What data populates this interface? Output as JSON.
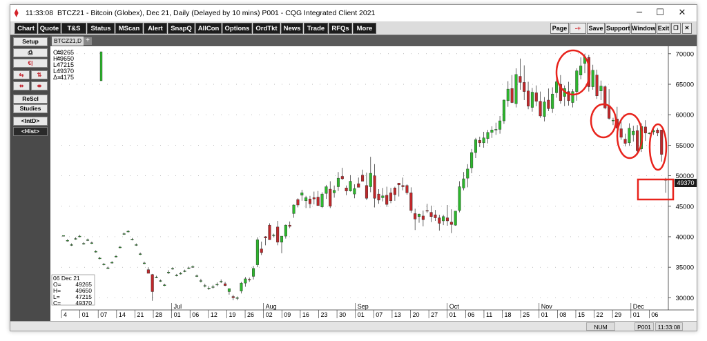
{
  "window": {
    "time": "11:33:08",
    "title": "BTCZ21 - Bitcoin (Globex), Dec 21, Daily (Delayed by 10 mins)  P001 - CQG Integrated Client 2021",
    "minimize_icon": "minimize-icon",
    "maximize_icon": "maximize-icon",
    "close_icon": "close-icon"
  },
  "toolbar": {
    "buttons": [
      "Chart",
      "Quote",
      "T&S",
      "Status",
      "MScan",
      "Alert",
      "SnapQ",
      "AllCon",
      "Options",
      "OrdTkt",
      "News",
      "Trade",
      "RFQs",
      "More"
    ],
    "right_buttons": [
      "Page",
      "-+",
      "Save",
      "Support",
      "Window",
      "Exit"
    ],
    "restore_icon": "restore-icon"
  },
  "side": {
    "setup": "Setup",
    "print_icon": "print-icon",
    "dollar_icon": "currency-icon",
    "rescl": "ReScl",
    "studies": "Studies",
    "intd": "<IntD>",
    "hist": "<Hist>"
  },
  "tab": {
    "label": "BTCZ21,D",
    "add": "+"
  },
  "ohlc_top": {
    "labels": [
      "O=",
      "H=",
      "L=",
      "L=",
      "Δ="
    ],
    "values": [
      "49265",
      "49650",
      "47215",
      "49370",
      "-4175"
    ]
  },
  "ohlc_box": {
    "date": "06 Dec 21",
    "labels": [
      "O=",
      "H=",
      "L=",
      "C="
    ],
    "values": [
      "49265",
      "49650",
      "47215",
      "49370"
    ]
  },
  "last_price_label": "49370",
  "status": {
    "num": "NUM",
    "page": "P001",
    "time": "11:33:08"
  },
  "chart_data": {
    "type": "candlestick",
    "ylim": [
      28000,
      71000
    ],
    "y_ticks": [
      30000,
      35000,
      40000,
      45000,
      50000,
      55000,
      60000,
      65000,
      70000
    ],
    "x_day_labels": [
      "4",
      "01",
      "07",
      "14",
      "21",
      "28",
      "01",
      "06",
      "12",
      "19",
      "26",
      "02",
      "09",
      "16",
      "23",
      "30",
      "01",
      "07",
      "13",
      "20",
      "27",
      "01",
      "06",
      "11",
      "18",
      "25",
      "01",
      "08",
      "15",
      "22",
      "29",
      "01",
      "06"
    ],
    "x_month_labels": [
      "Jul",
      "Aug",
      "Sep",
      "Oct",
      "Nov",
      "Dec"
    ],
    "colors": {
      "up": "#2db82d",
      "down": "#c0282b",
      "highlight": "#e8231c",
      "price_label_bg": "#1a1a1a"
    },
    "candles": [
      [
        40200,
        40200,
        40200,
        40200
      ],
      [
        39400,
        39600,
        39200,
        39400
      ],
      [
        38700,
        38900,
        38500,
        38700
      ],
      [
        39700,
        39900,
        39500,
        39700
      ],
      [
        40100,
        40300,
        39900,
        40100
      ],
      [
        38900,
        39100,
        38700,
        38900
      ],
      [
        39500,
        39700,
        39300,
        39500
      ],
      [
        39000,
        39200,
        38800,
        39000
      ],
      [
        37600,
        37800,
        37400,
        37600
      ],
      [
        36500,
        36700,
        36300,
        36500
      ],
      [
        35500,
        35700,
        35300,
        35500
      ],
      [
        34900,
        35100,
        34700,
        34900
      ],
      [
        35800,
        36000,
        35600,
        35800
      ],
      [
        36800,
        37000,
        36600,
        36800
      ],
      [
        38300,
        38500,
        38100,
        38300
      ],
      [
        40500,
        40700,
        40300,
        40500
      ],
      [
        40900,
        41100,
        40700,
        40900
      ],
      [
        39600,
        39800,
        39400,
        39600
      ],
      [
        38700,
        38900,
        38500,
        38700
      ],
      [
        37200,
        37400,
        37000,
        37200
      ],
      [
        35700,
        35900,
        35500,
        35700
      ],
      [
        34600,
        35000,
        34000,
        34000
      ],
      [
        33800,
        33900,
        29500,
        31000
      ],
      [
        33400,
        33600,
        33200,
        33400
      ],
      [
        32800,
        33000,
        32600,
        32800
      ],
      [
        32100,
        32300,
        31900,
        32100
      ],
      [
        34200,
        34500,
        33900,
        34200
      ],
      [
        34800,
        35000,
        34600,
        34800
      ],
      [
        33700,
        33900,
        33500,
        33700
      ],
      [
        34000,
        34200,
        33800,
        34000
      ],
      [
        34400,
        34600,
        34200,
        34400
      ],
      [
        34900,
        35100,
        34700,
        34900
      ],
      [
        35100,
        35300,
        34900,
        35100
      ],
      [
        33600,
        33800,
        33400,
        33600
      ],
      [
        32800,
        33100,
        32500,
        32800
      ],
      [
        32000,
        32300,
        31700,
        32000
      ],
      [
        31600,
        31900,
        31300,
        31600
      ],
      [
        31800,
        32100,
        31500,
        31800
      ],
      [
        32200,
        32500,
        31900,
        32200
      ],
      [
        32700,
        33000,
        32400,
        32700
      ],
      [
        32300,
        32600,
        31900,
        32000
      ],
      [
        31000,
        31500,
        30500,
        31500
      ],
      [
        30200,
        30500,
        29600,
        30000
      ],
      [
        30000,
        30200,
        29600,
        30000
      ],
      [
        31100,
        32600,
        30700,
        32400
      ],
      [
        32400,
        33400,
        31800,
        33100
      ],
      [
        33000,
        33300,
        32600,
        32900
      ],
      [
        33500,
        35200,
        33000,
        34800
      ],
      [
        35400,
        39900,
        35000,
        39500
      ],
      [
        38000,
        39200,
        37000,
        37400
      ],
      [
        40000,
        40100,
        38600,
        39800
      ],
      [
        41900,
        42200,
        39700,
        39500
      ],
      [
        40200,
        40500,
        39900,
        40300
      ],
      [
        41600,
        42600,
        38600,
        39100
      ],
      [
        39100,
        40100,
        37300,
        40100
      ],
      [
        40100,
        42000,
        39700,
        41900
      ],
      [
        41900,
        42500,
        41400,
        41700
      ],
      [
        43800,
        45300,
        43100,
        45200
      ],
      [
        46100,
        46300,
        44800,
        45200
      ],
      [
        46800,
        47700,
        45900,
        47200
      ],
      [
        45900,
        46700,
        44700,
        46400
      ],
      [
        46200,
        46700,
        44700,
        45400
      ],
      [
        46400,
        47400,
        45300,
        46200
      ],
      [
        46500,
        47500,
        45200,
        45100
      ],
      [
        44900,
        47300,
        44700,
        47000
      ],
      [
        47100,
        48500,
        46200,
        48200
      ],
      [
        47800,
        49100,
        44700,
        45000
      ],
      [
        47200,
        48400,
        46400,
        47600
      ],
      [
        48200,
        50600,
        47500,
        49600
      ],
      [
        49900,
        51300,
        49300,
        49500
      ],
      [
        48000,
        48400,
        46800,
        47500
      ],
      [
        47500,
        50100,
        47400,
        49100
      ],
      [
        47000,
        48600,
        46300,
        47900
      ],
      [
        48700,
        49700,
        48300,
        48100
      ],
      [
        50100,
        51000,
        49300,
        49100
      ],
      [
        48400,
        50500,
        46000,
        46300
      ],
      [
        48200,
        53100,
        47300,
        50400
      ],
      [
        50000,
        51900,
        44800,
        46300
      ],
      [
        47000,
        47800,
        45400,
        46000
      ],
      [
        46400,
        48000,
        45800,
        46700
      ],
      [
        46800,
        48200,
        44900,
        45300
      ],
      [
        47200,
        48000,
        45500,
        45900
      ],
      [
        48000,
        48200,
        45900,
        46900
      ],
      [
        48800,
        48600,
        46600,
        48500
      ],
      [
        48400,
        49700,
        47600,
        48200
      ],
      [
        48400,
        48600,
        46900,
        47200
      ],
      [
        47200,
        48100,
        43900,
        44300
      ],
      [
        43800,
        44600,
        41100,
        42900
      ],
      [
        43300,
        43800,
        42300,
        43700
      ],
      [
        43400,
        44300,
        41700,
        42800
      ],
      [
        44300,
        45400,
        43900,
        44200
      ],
      [
        44000,
        45100,
        42400,
        43300
      ],
      [
        43600,
        44400,
        42600,
        43100
      ],
      [
        43100,
        43600,
        41000,
        42200
      ],
      [
        42600,
        43600,
        41900,
        43300
      ],
      [
        43100,
        45200,
        41800,
        42600
      ],
      [
        42400,
        44500,
        40600,
        42000
      ],
      [
        41900,
        44000,
        41800,
        44200
      ],
      [
        44300,
        49100,
        44000,
        48200
      ],
      [
        48000,
        50600,
        47600,
        49500
      ],
      [
        49600,
        51900,
        48100,
        51100
      ],
      [
        51300,
        54400,
        50400,
        53800
      ],
      [
        53800,
        56200,
        52900,
        55900
      ],
      [
        55800,
        56400,
        54700,
        55400
      ],
      [
        55400,
        57200,
        54600,
        56200
      ],
      [
        56100,
        57500,
        55300,
        57100
      ],
      [
        57100,
        58100,
        56200,
        57500
      ],
      [
        57500,
        58700,
        56700,
        57600
      ],
      [
        57600,
        59800,
        56900,
        59000
      ],
      [
        59000,
        62500,
        58500,
        62400
      ],
      [
        62300,
        65500,
        61300,
        64200
      ],
      [
        64300,
        66500,
        61900,
        62000
      ],
      [
        61800,
        67600,
        61200,
        66600
      ],
      [
        66300,
        69200,
        64100,
        65300
      ],
      [
        65300,
        68100,
        62400,
        63800
      ],
      [
        63900,
        65400,
        60900,
        61400
      ],
      [
        61200,
        64400,
        60500,
        63700
      ],
      [
        63600,
        64800,
        61400,
        62200
      ],
      [
        62200,
        63800,
        59500,
        59800
      ],
      [
        59700,
        62900,
        58900,
        62100
      ],
      [
        62400,
        64300,
        60600,
        61000
      ],
      [
        61000,
        64500,
        60300,
        63400
      ],
      [
        63600,
        66200,
        62800,
        65400
      ],
      [
        65000,
        66500,
        61800,
        62300
      ],
      [
        63000,
        64800,
        61400,
        64300
      ],
      [
        63800,
        65400,
        61500,
        62300
      ],
      [
        62000,
        64200,
        61200,
        63800
      ],
      [
        63800,
        67600,
        62300,
        67200
      ],
      [
        66500,
        69400,
        65800,
        68000
      ],
      [
        68400,
        70000,
        66800,
        69500
      ],
      [
        69400,
        69800,
        63800,
        64600
      ],
      [
        64600,
        68200,
        64100,
        67300
      ],
      [
        66500,
        67400,
        62600,
        63100
      ],
      [
        63900,
        65600,
        62400,
        64700
      ],
      [
        64600,
        64800,
        60900,
        61100
      ],
      [
        61500,
        64200,
        59200,
        59400
      ],
      [
        59000,
        59500,
        58300,
        59100
      ],
      [
        59300,
        61300,
        58600,
        57800
      ],
      [
        57700,
        59200,
        55900,
        56300
      ],
      [
        56000,
        56900,
        54800,
        55300
      ],
      [
        55400,
        58600,
        54900,
        57800
      ],
      [
        56700,
        58200,
        55600,
        57300
      ],
      [
        57400,
        58300,
        53400,
        54100
      ],
      [
        54400,
        58600,
        53900,
        58100
      ],
      [
        58000,
        59100,
        55700,
        57000
      ],
      [
        57000,
        57100,
        56800,
        57000
      ],
      [
        57200,
        58000,
        56700,
        57400
      ],
      [
        57500,
        57800,
        56500,
        57000
      ],
      [
        57500,
        57500,
        52300,
        53500
      ],
      [
        49265,
        49650,
        47215,
        49370
      ]
    ]
  }
}
